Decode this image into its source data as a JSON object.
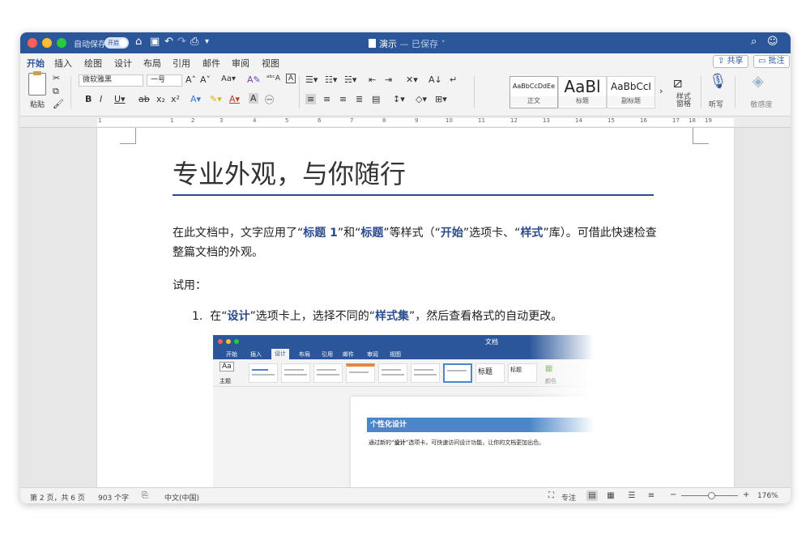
{
  "titlebar": {
    "autosave_label": "自动保存",
    "autosave_state": "开启",
    "doc_title": "演示",
    "saved_status": "— 已保存 ˅"
  },
  "tabs": [
    "开始",
    "插入",
    "绘图",
    "设计",
    "布局",
    "引用",
    "邮件",
    "审阅",
    "视图"
  ],
  "active_tab": "开始",
  "share_label": "共享",
  "comment_label": "批注",
  "ribbon": {
    "paste_label": "粘贴",
    "font_name": "微软雅黑",
    "font_size": "一号",
    "styles": [
      {
        "sample": "AaBbCcDdEe",
        "caption": "正文"
      },
      {
        "sample": "AaBl",
        "caption": "标题"
      },
      {
        "sample": "AaBbCcI",
        "caption": "副标题"
      }
    ],
    "styles_pane_label": "样式\n窗格",
    "dictate_label": "听写",
    "sensitivity_label": "敏感度"
  },
  "ruler_numbers": [
    "1",
    "1",
    "2",
    "3",
    "4",
    "5",
    "6",
    "7",
    "8",
    "9",
    "10",
    "11",
    "12",
    "13",
    "14",
    "15",
    "16",
    "17",
    "18",
    "19"
  ],
  "document": {
    "heading": "专业外观，与你随行",
    "para_part1": "在此文档中，文字应用了“",
    "para_b1": "标题 1",
    "para_part2": "”和“",
    "para_b2": "标题",
    "para_part3": "”等样式（“",
    "para_b3": "开始",
    "para_part4": "”选项卡、“",
    "para_b4": "样式",
    "para_part5": "”库）。可借此快速检查整篇文档的外观。",
    "tryit": "试用：",
    "list_num": "1.",
    "list_part1": "在“",
    "list_b1": "设计",
    "list_part2": "”选项卡上，选择不同的“",
    "list_b2": "样式集",
    "list_part3": "”，然后查看格式的自动更改。"
  },
  "embedded": {
    "title": "文档",
    "tabs": [
      "开始",
      "插入",
      "设计",
      "布局",
      "引用",
      "邮件",
      "审阅",
      "视图"
    ],
    "active_tab": "设计",
    "theme_label": "主题",
    "style_label_1": "标题",
    "style_label_2": "标题",
    "color_label": "颜色",
    "heading": "个性化设计",
    "body_part1": "通过新的“",
    "body_bold": "设计",
    "body_part2": "”选项卡，可快速访问设计功能，让你的文档更加出色。"
  },
  "statusbar": {
    "page_info": "第 2 页，共 6 页",
    "word_count": "903 个字",
    "language": "中文(中国)",
    "focus_label": "专注",
    "zoom_minus": "−",
    "zoom_plus": "+",
    "zoom_level": "176%"
  },
  "colors": {
    "accent": "#2b579a",
    "heading_rule": "#2b4c8c",
    "embedded_heading": "#4a86c8"
  }
}
